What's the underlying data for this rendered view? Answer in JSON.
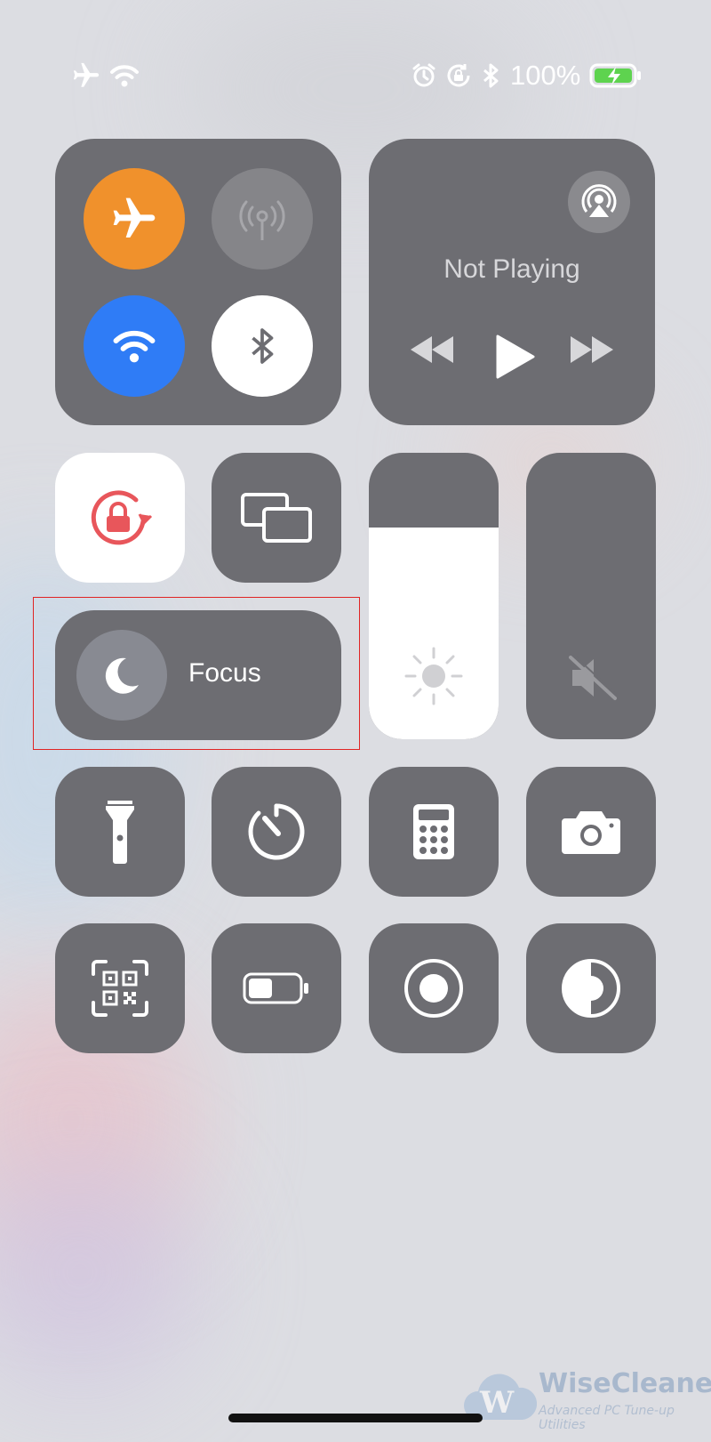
{
  "status_bar": {
    "battery_percent": "100%",
    "icons": [
      "airplane-icon",
      "wifi-icon",
      "alarm-icon",
      "rotation-lock-icon",
      "bluetooth-icon",
      "battery-charging-icon"
    ]
  },
  "connectivity": {
    "airplane_mode": {
      "state": "on",
      "color": "#f0912c"
    },
    "cellular_data": {
      "state": "off"
    },
    "wifi": {
      "state": "on",
      "color": "#2f7cf6"
    },
    "bluetooth": {
      "state": "on",
      "color": "#ffffff"
    }
  },
  "now_playing": {
    "label": "Not Playing",
    "controls": [
      "rewind-icon",
      "play-icon",
      "fast-forward-icon"
    ]
  },
  "orientation_lock": {
    "state": "on",
    "color": "#e8565b"
  },
  "screen_mirroring": {
    "icon": "screen-mirroring-icon"
  },
  "focus": {
    "label": "Focus",
    "icon": "moon-icon"
  },
  "brightness": {
    "level_percent": 74
  },
  "volume": {
    "level_percent": 0,
    "muted": true
  },
  "quick_controls": [
    "flashlight-icon",
    "timer-icon",
    "calculator-icon",
    "camera-icon",
    "qr-code-scanner-icon",
    "low-power-mode-icon",
    "screen-recording-icon",
    "dark-mode-icon"
  ],
  "highlight": {
    "target": "focus",
    "color": "#e02424"
  },
  "watermark": {
    "brand": "WiseCleaner",
    "tagline": "Advanced PC Tune-up Utilities"
  }
}
